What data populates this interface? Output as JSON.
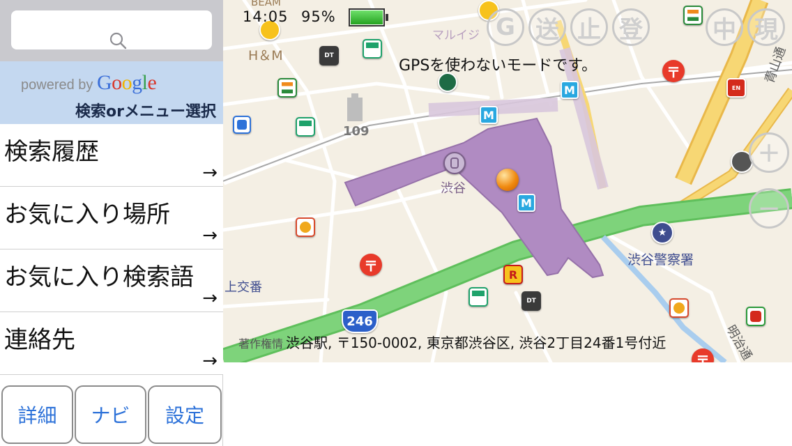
{
  "search": {
    "placeholder": ""
  },
  "google": {
    "powered_by": "powered by",
    "brand_letters": [
      "G",
      "o",
      "o",
      "g",
      "l",
      "e"
    ]
  },
  "menu": {
    "hint": "検索orメニュー選択",
    "items": [
      {
        "label": "検索履歴",
        "arrow": "→"
      },
      {
        "label": "お気に入り場所",
        "arrow": "→"
      },
      {
        "label": "お気に入り検索語",
        "arrow": "→"
      },
      {
        "label": "連絡先",
        "arrow": "→"
      }
    ]
  },
  "bottom_buttons": {
    "detail": "詳細",
    "navi": "ナビ",
    "settings": "設定"
  },
  "status": {
    "time": "14:05",
    "battery": "95%"
  },
  "map": {
    "gps_message": "GPSを使わないモードです。",
    "address": "渋谷駅, 〒150-0002, 東京都渋谷区, 渋谷2丁目24番1号付近",
    "copyright": "著作権情",
    "zoom_in": "+",
    "zoom_out": "−",
    "labels": {
      "station": "渋谷",
      "police": "渋谷警察署",
      "hm": "H＆M",
      "shibuya109": "109",
      "kamiko": "上交番",
      "marui": "マルイジ",
      "beam": "BEAM",
      "aoyama": "青山通",
      "meiji": "明治通",
      "route": "246"
    },
    "overlay_buttons": [
      "G",
      "送",
      "止",
      "登",
      "中",
      "現"
    ]
  },
  "colors": {
    "accent_blue": "#2d72d9",
    "station_purple": "#b08bc2",
    "green_road": "#7ed37b",
    "yellow_road": "#f7d774",
    "post_red": "#e83a2a",
    "metro_blue": "#29a8e0"
  }
}
